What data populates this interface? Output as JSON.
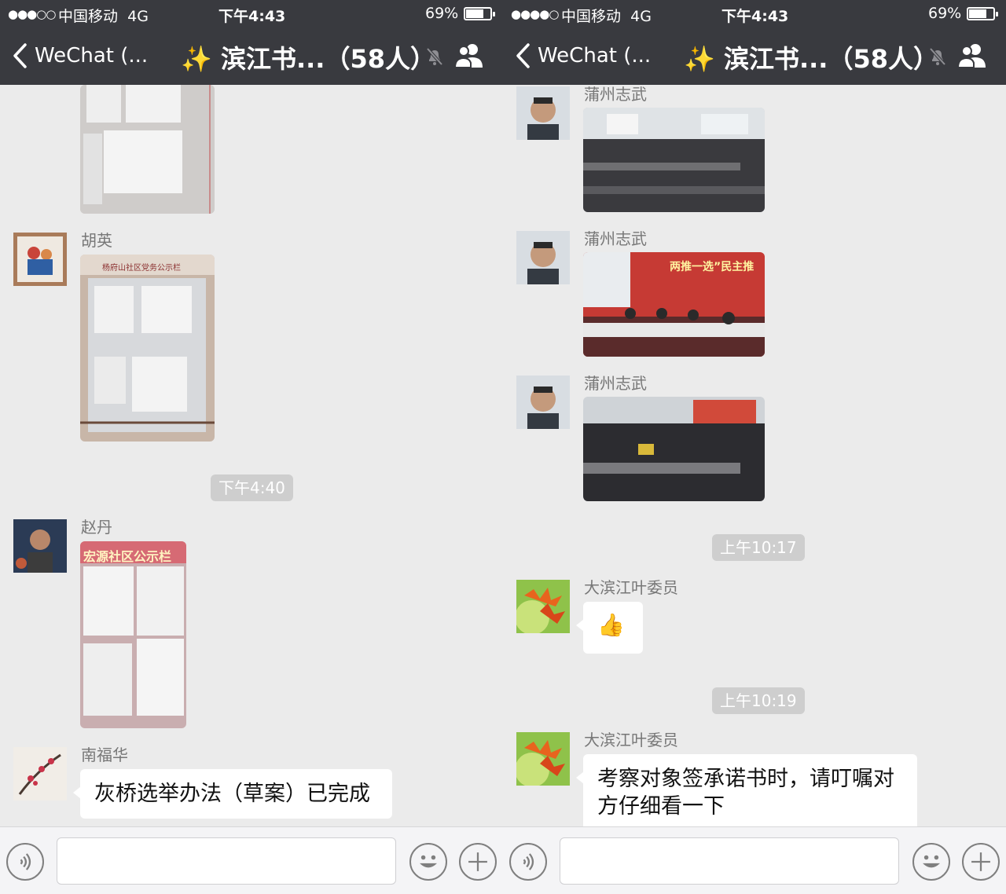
{
  "status": {
    "dots": "●●●○○",
    "dots_right": "●●●●○",
    "carrier": "中国移动",
    "network": "4G",
    "time": "下午4:43",
    "battery": "69%"
  },
  "nav": {
    "back_label": "WeChat (...",
    "title": "滨江书...（58人）",
    "sparkle": "✨"
  },
  "left_chat": {
    "messages": [
      {
        "sender": "胡英",
        "type": "image"
      },
      {
        "sender": "赵丹",
        "type": "image"
      },
      {
        "sender": "南福华",
        "type": "text",
        "text": "灰桥选举办法（草案）已完成"
      }
    ],
    "timestamps": [
      "下午4:40"
    ],
    "image_captions": [
      "杨府山社区党务公示栏",
      "宏源社区公示栏"
    ]
  },
  "right_chat": {
    "messages": [
      {
        "sender": "蒲州志武",
        "type": "image"
      },
      {
        "sender": "蒲州志武",
        "type": "image"
      },
      {
        "sender": "蒲州志武",
        "type": "image"
      },
      {
        "sender": "大滨江叶委员",
        "type": "sticker",
        "text": "👍"
      },
      {
        "sender": "大滨江叶委员",
        "type": "text",
        "text": "考察对象签承诺书时，请叮嘱对方仔细看一下"
      }
    ],
    "timestamps": [
      "上午10:17",
      "上午10:19"
    ],
    "banner_text": "两推一选”民主推"
  },
  "colors": {
    "nav_bg": "#393a3f",
    "chat_bg": "#ebebeb",
    "bubble": "#ffffff",
    "timestamp_bg": "#cecece"
  },
  "icons": [
    "back-chevron-icon",
    "mute-bell-icon",
    "group-members-icon",
    "voice-icon",
    "emoji-icon",
    "plus-icon",
    "thumbs-up-icon"
  ]
}
